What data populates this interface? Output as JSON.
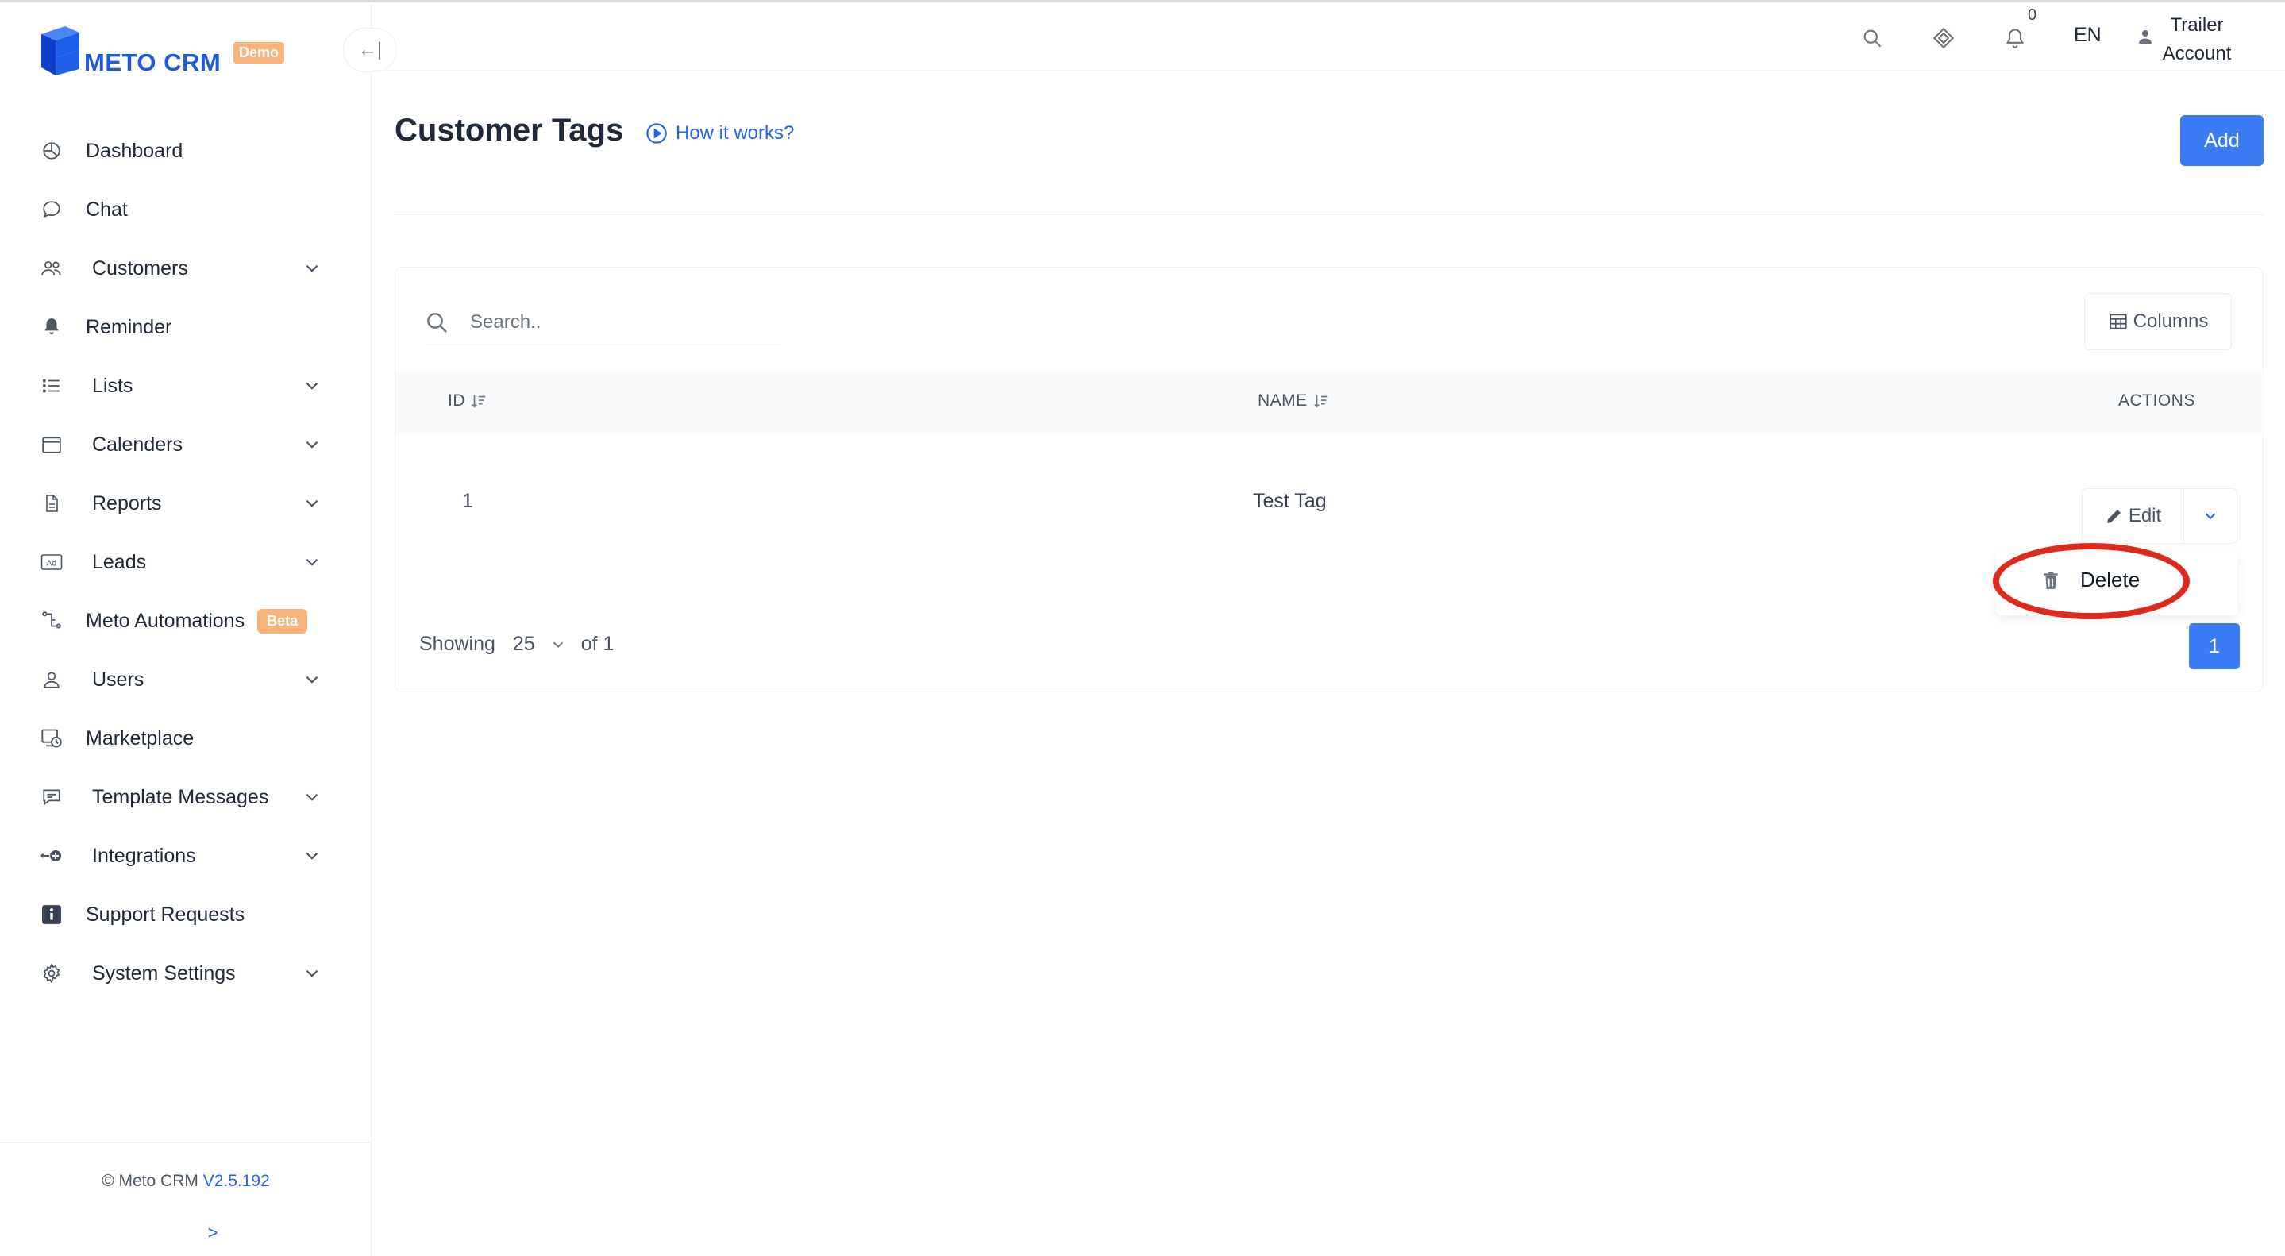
{
  "brand": {
    "name": "METO CRM",
    "badge": "Demo",
    "collapse_glyph": "←|"
  },
  "header": {
    "notification_count": "0",
    "language": "EN",
    "account_line1": "Trailer",
    "account_line2": "Account",
    "icons": [
      "search-icon",
      "diamond-icon",
      "bell-icon",
      "user-icon"
    ]
  },
  "sidebar": {
    "items": [
      {
        "label": "Dashboard",
        "icon": "dashboard-icon",
        "has_chevron": false
      },
      {
        "label": "Chat",
        "icon": "chat-icon",
        "has_chevron": false
      },
      {
        "label": "Customers",
        "icon": "customers-icon",
        "has_chevron": true
      },
      {
        "label": "Reminder",
        "icon": "bell-icon",
        "has_chevron": false
      },
      {
        "label": "Lists",
        "icon": "list-icon",
        "has_chevron": true
      },
      {
        "label": "Calenders",
        "icon": "calendar-icon",
        "has_chevron": true
      },
      {
        "label": "Reports",
        "icon": "report-icon",
        "has_chevron": true
      },
      {
        "label": "Leads",
        "icon": "ad-icon",
        "has_chevron": true
      },
      {
        "label": "Meto Automations",
        "icon": "automation-icon",
        "has_chevron": false,
        "badge": "Beta"
      },
      {
        "label": "Users",
        "icon": "user-icon",
        "has_chevron": true
      },
      {
        "label": "Marketplace",
        "icon": "marketplace-icon",
        "has_chevron": false
      },
      {
        "label": "Template Messages",
        "icon": "message-template-icon",
        "has_chevron": true
      },
      {
        "label": "Integrations",
        "icon": "integration-icon",
        "has_chevron": true
      },
      {
        "label": "Support Requests",
        "icon": "info-icon",
        "has_chevron": false
      },
      {
        "label": "System Settings",
        "icon": "gear-icon",
        "has_chevron": true
      }
    ],
    "footer": {
      "copyright": "© Meto CRM",
      "version": "V2.5.192",
      "expand": ">"
    }
  },
  "page": {
    "title": "Customer Tags",
    "help_link": "How it works?",
    "add_label": "Add"
  },
  "table": {
    "search_placeholder": "Search..",
    "columns_label": "Columns",
    "headers": {
      "id": "ID",
      "name": "NAME",
      "actions": "ACTIONS"
    },
    "rows": [
      {
        "id": "1",
        "name": "Test Tag"
      }
    ],
    "edit_label": "Edit",
    "dropdown": {
      "delete_label": "Delete"
    }
  },
  "pagination": {
    "showing_label": "Showing",
    "per_page": "25",
    "of_label": "of 1",
    "current_page": "1"
  },
  "colors": {
    "primary": "#3b7cf5",
    "brand": "#1f5bd8",
    "badge": "#f6b37a",
    "highlight": "#dc2a1f"
  }
}
